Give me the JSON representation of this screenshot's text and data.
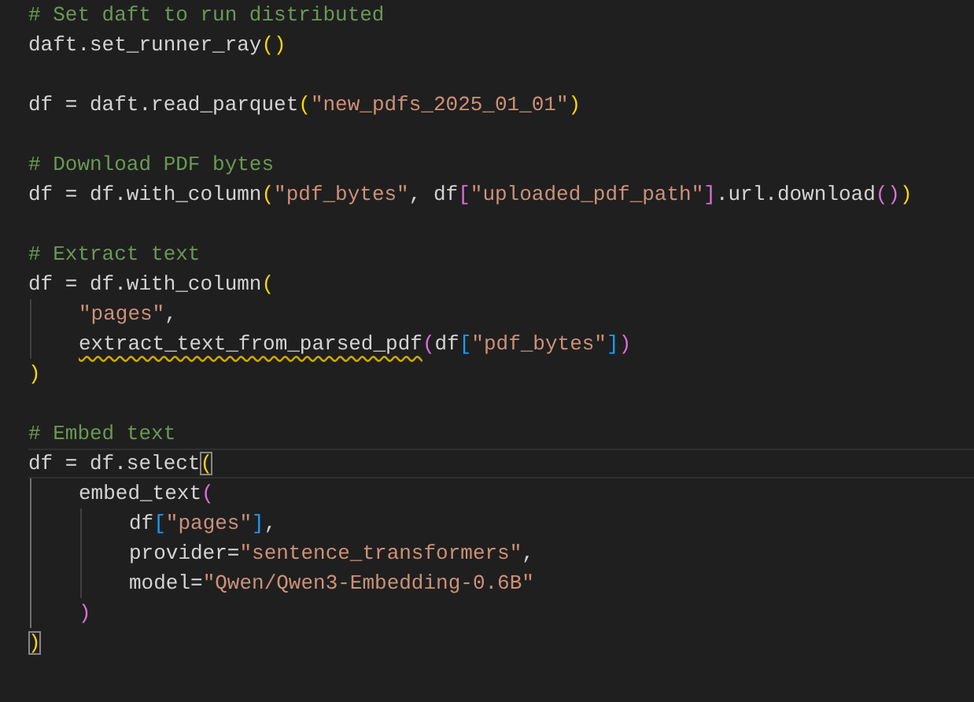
{
  "editor": {
    "lines": [
      {
        "kind": "code",
        "current": false,
        "tokens": [
          {
            "text": "# Set daft to run distributed",
            "kind": "comment",
            "warning": false,
            "matched": false
          }
        ]
      },
      {
        "kind": "code",
        "current": false,
        "tokens": [
          {
            "text": "daft.set_runner_ray",
            "kind": "plain",
            "warning": false,
            "matched": false
          },
          {
            "text": "()",
            "kind": "bracket1",
            "warning": false,
            "matched": false
          }
        ]
      },
      {
        "kind": "blank"
      },
      {
        "kind": "code",
        "current": false,
        "tokens": [
          {
            "text": "df = daft.read_parquet",
            "kind": "plain",
            "warning": false,
            "matched": false
          },
          {
            "text": "(",
            "kind": "bracket1",
            "warning": false,
            "matched": false
          },
          {
            "text": "\"new_pdfs_2025_01_01\"",
            "kind": "string",
            "warning": false,
            "matched": false
          },
          {
            "text": ")",
            "kind": "bracket1",
            "warning": false,
            "matched": false
          }
        ]
      },
      {
        "kind": "blank"
      },
      {
        "kind": "code",
        "current": false,
        "tokens": [
          {
            "text": "# Download PDF bytes",
            "kind": "comment",
            "warning": false,
            "matched": false
          }
        ]
      },
      {
        "kind": "code",
        "current": false,
        "tokens": [
          {
            "text": "df = df.with_column",
            "kind": "plain",
            "warning": false,
            "matched": false
          },
          {
            "text": "(",
            "kind": "bracket1",
            "warning": false,
            "matched": false
          },
          {
            "text": "\"pdf_bytes\"",
            "kind": "string",
            "warning": false,
            "matched": false
          },
          {
            "text": ", df",
            "kind": "plain",
            "warning": false,
            "matched": false
          },
          {
            "text": "[",
            "kind": "bracket2",
            "warning": false,
            "matched": false
          },
          {
            "text": "\"uploaded_pdf_path\"",
            "kind": "string",
            "warning": false,
            "matched": false
          },
          {
            "text": "]",
            "kind": "bracket2",
            "warning": false,
            "matched": false
          },
          {
            "text": ".url.download",
            "kind": "plain",
            "warning": false,
            "matched": false
          },
          {
            "text": "()",
            "kind": "bracket2",
            "warning": false,
            "matched": false
          },
          {
            "text": ")",
            "kind": "bracket1",
            "warning": false,
            "matched": false
          }
        ]
      },
      {
        "kind": "blank"
      },
      {
        "kind": "code",
        "current": false,
        "tokens": [
          {
            "text": "# Extract text",
            "kind": "comment",
            "warning": false,
            "matched": false
          }
        ]
      },
      {
        "kind": "code",
        "current": false,
        "tokens": [
          {
            "text": "df = df.with_column",
            "kind": "plain",
            "warning": false,
            "matched": false
          },
          {
            "text": "(",
            "kind": "bracket1",
            "warning": false,
            "matched": false
          }
        ],
        "children": [
          {
            "kind": "code",
            "current": false,
            "tokens": [
              {
                "text": "\"pages\"",
                "kind": "string",
                "warning": false,
                "matched": false
              },
              {
                "text": ",",
                "kind": "plain",
                "warning": false,
                "matched": false
              }
            ]
          },
          {
            "kind": "code",
            "current": false,
            "tokens": [
              {
                "text": "extract_text_from_parsed_pdf",
                "kind": "plain",
                "warning": true,
                "matched": false
              },
              {
                "text": "(",
                "kind": "bracket2",
                "warning": false,
                "matched": false
              },
              {
                "text": "df",
                "kind": "plain",
                "warning": false,
                "matched": false
              },
              {
                "text": "[",
                "kind": "bracket3",
                "warning": false,
                "matched": false
              },
              {
                "text": "\"pdf_bytes\"",
                "kind": "string",
                "warning": false,
                "matched": false
              },
              {
                "text": "]",
                "kind": "bracket3",
                "warning": false,
                "matched": false
              },
              {
                "text": ")",
                "kind": "bracket2",
                "warning": false,
                "matched": false
              }
            ]
          }
        ]
      },
      {
        "kind": "code",
        "current": false,
        "tokens": [
          {
            "text": ")",
            "kind": "bracket1",
            "warning": false,
            "matched": false
          }
        ]
      },
      {
        "kind": "blank"
      },
      {
        "kind": "code",
        "current": false,
        "tokens": [
          {
            "text": "# Embed text",
            "kind": "comment",
            "warning": false,
            "matched": false
          }
        ]
      },
      {
        "kind": "code",
        "current": true,
        "tokens": [
          {
            "text": "df = df.select",
            "kind": "plain",
            "warning": false,
            "matched": false
          },
          {
            "text": "(",
            "kind": "bracket1",
            "warning": false,
            "matched": true
          }
        ],
        "children": [
          {
            "kind": "code",
            "current": false,
            "tokens": [
              {
                "text": "embed_text",
                "kind": "plain",
                "warning": false,
                "matched": false
              },
              {
                "text": "(",
                "kind": "bracket2",
                "warning": false,
                "matched": false
              }
            ],
            "children": [
              {
                "kind": "code",
                "current": false,
                "tokens": [
                  {
                    "text": "df",
                    "kind": "plain",
                    "warning": false,
                    "matched": false
                  },
                  {
                    "text": "[",
                    "kind": "bracket3",
                    "warning": false,
                    "matched": false
                  },
                  {
                    "text": "\"pages\"",
                    "kind": "string",
                    "warning": false,
                    "matched": false
                  },
                  {
                    "text": "]",
                    "kind": "bracket3",
                    "warning": false,
                    "matched": false
                  },
                  {
                    "text": ",",
                    "kind": "plain",
                    "warning": false,
                    "matched": false
                  }
                ]
              },
              {
                "kind": "code",
                "current": false,
                "tokens": [
                  {
                    "text": "provider=",
                    "kind": "plain",
                    "warning": false,
                    "matched": false
                  },
                  {
                    "text": "\"sentence_transformers\"",
                    "kind": "string",
                    "warning": false,
                    "matched": false
                  },
                  {
                    "text": ",",
                    "kind": "plain",
                    "warning": false,
                    "matched": false
                  }
                ]
              },
              {
                "kind": "code",
                "current": false,
                "tokens": [
                  {
                    "text": "model=",
                    "kind": "plain",
                    "warning": false,
                    "matched": false
                  },
                  {
                    "text": "\"Qwen/Qwen3-Embedding-0.6B\"",
                    "kind": "string",
                    "warning": false,
                    "matched": false
                  }
                ]
              }
            ]
          },
          {
            "kind": "code",
            "current": false,
            "tokens": [
              {
                "text": ")",
                "kind": "bracket2",
                "warning": false,
                "matched": false
              }
            ]
          }
        ]
      },
      {
        "kind": "code",
        "current": false,
        "tokens": [
          {
            "text": ")",
            "kind": "bracket1",
            "warning": false,
            "matched": true
          }
        ]
      }
    ]
  }
}
